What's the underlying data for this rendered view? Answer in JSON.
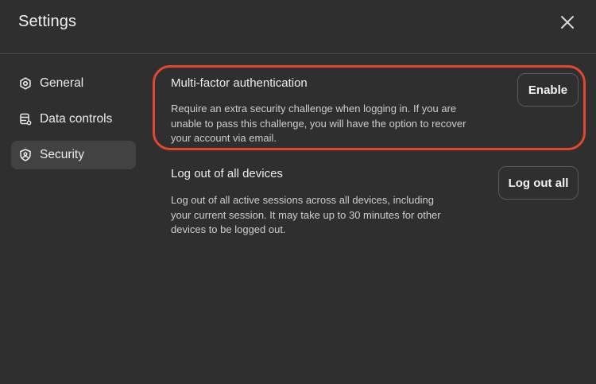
{
  "dialog": {
    "title": "Settings",
    "close_icon": "close-icon"
  },
  "sidebar": {
    "items": [
      {
        "label": "General",
        "icon": "gear-icon",
        "active": false
      },
      {
        "label": "Data controls",
        "icon": "database-settings-icon",
        "active": false
      },
      {
        "label": "Security",
        "icon": "shield-icon",
        "active": true
      }
    ]
  },
  "security": {
    "mfa": {
      "title": "Multi-factor authentication",
      "description_lines": [
        "Require an extra security challenge when logging in. If you are",
        "unable to pass this challenge, you will have the option to recover",
        "your account via email."
      ],
      "button_label": "Enable"
    },
    "logout": {
      "title": "Log out of all devices",
      "description_lines": [
        "Log out of all active sessions across all devices, including",
        "your current session. It may take up to 30 minutes for other",
        "devices to be logged out."
      ],
      "button_label": "Log out all"
    }
  },
  "colors": {
    "background": "#2f2f2f",
    "active_item": "#424242",
    "highlight_border": "#e5462f",
    "text": "#ececec"
  }
}
